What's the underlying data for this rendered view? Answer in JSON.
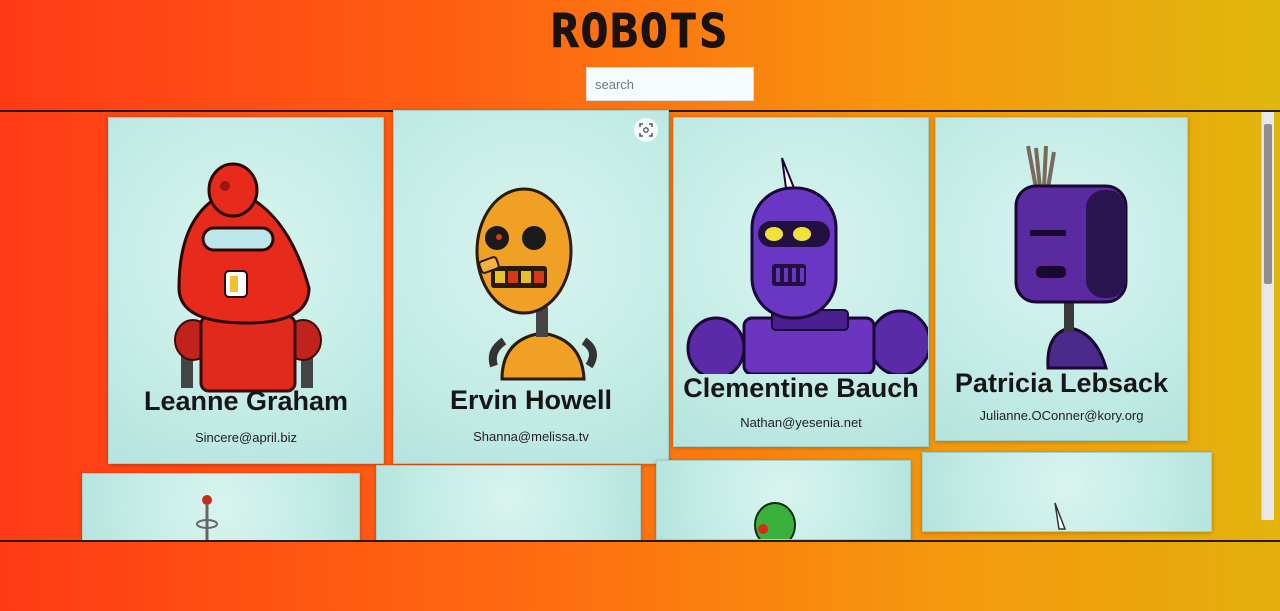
{
  "app": {
    "title": "ROBOTS"
  },
  "search": {
    "placeholder": "search"
  },
  "robots": [
    {
      "name": "Leanne Graham",
      "email": "Sincere@april.biz"
    },
    {
      "name": "Ervin Howell",
      "email": "Shanna@melissa.tv"
    },
    {
      "name": "Clementine Bauch",
      "email": "Nathan@yesenia.net"
    },
    {
      "name": "Patricia Lebsack",
      "email": "Julianne.OConner@kory.org"
    }
  ],
  "icons": {
    "image_search": "scan-icon"
  },
  "colors": {
    "background_start": "#ff3b17",
    "background_end": "#e3b40c",
    "card": "#c4ece6"
  }
}
